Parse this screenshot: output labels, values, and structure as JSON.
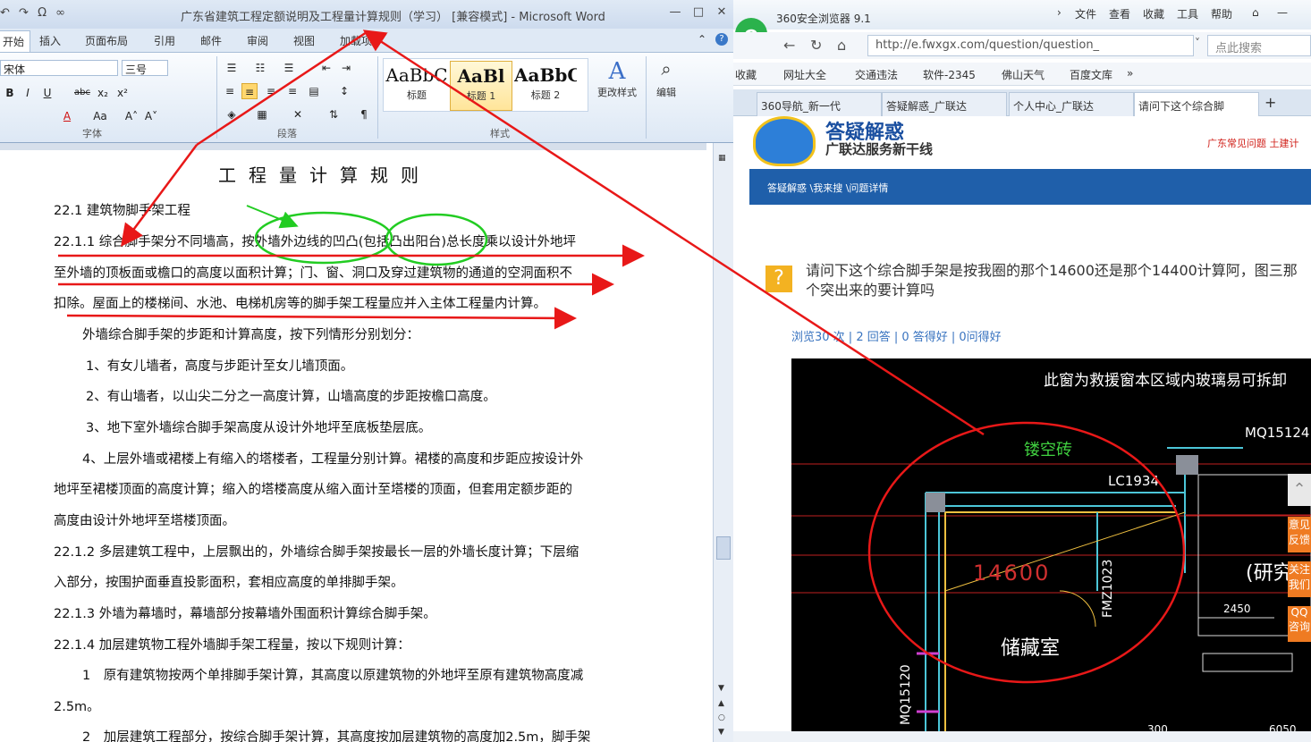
{
  "word": {
    "title": "广东省建筑工程定额说明及工程量计算规则（学习） [兼容模式] - Microsoft Word",
    "qat": [
      "↶",
      "↷",
      "Ω",
      "∞"
    ],
    "window_controls": [
      "—",
      "□",
      "✕"
    ],
    "tabs": [
      "开始",
      "插入",
      "页面布局",
      "引用",
      "邮件",
      "审阅",
      "视图",
      "加载项"
    ],
    "help_icons": [
      "⌃",
      "?"
    ],
    "ribbon": {
      "font_name": "宋体",
      "font_size": "三号",
      "group_font": "字体",
      "group_paragraph": "段落",
      "group_styles": "样式",
      "styles": [
        {
          "preview": "AaBbC",
          "label": "标题"
        },
        {
          "preview": "AaBl",
          "label": "标题 1"
        },
        {
          "preview": "AaBbC",
          "label": "标题 2"
        }
      ],
      "change_styles": "更改样式",
      "edit": "编辑",
      "format_buttons": [
        "B",
        "I",
        "U",
        "abc",
        "x₂",
        "x²",
        "A",
        "Aa",
        "A˄",
        "A˅"
      ]
    },
    "document": {
      "heading": "工程量计算规则",
      "lines": [
        "22.1 建筑物脚手架工程",
        "22.1.1 综合脚手架分不同墙高，按外墙外边线的凹凸(包括凸出阳台)总长度乘以设计外地坪",
        "至外墙的顶板面或檐口的高度以面积计算；门、窗、洞口及穿过建筑物的通道的空洞面积不",
        "扣除。屋面上的楼梯间、水池、电梯机房等的脚手架工程量应并入主体工程量内计算。",
        "外墙综合脚手架的步距和计算高度，按下列情形分别划分：",
        "1、有女儿墙者，高度与步距计至女儿墙顶面。",
        "2、有山墙者，以山尖二分之一高度计算，山墙高度的步距按檐口高度。",
        "3、地下室外墙综合脚手架高度从设计外地坪至底板垫层底。",
        "4、上层外墙或裙楼上有缩入的塔楼者，工程量分别计算。裙楼的高度和步距应按设计外",
        "地坪至裙楼顶面的高度计算；缩入的塔楼高度从缩入面计至塔楼的顶面，但套用定额步距的",
        "高度由设计外地坪至塔楼顶面。",
        "22.1.2 多层建筑工程中，上层飘出的，外墙综合脚手架按最长一层的外墙长度计算；下层缩",
        "入部分，按围护面垂直投影面积，套相应高度的单排脚手架。",
        "22.1.3 外墙为幕墙时，幕墙部分按幕墙外围面积计算综合脚手架。",
        "22.1.4 加层建筑物工程外墙脚手架工程量，按以下规则计算：",
        "1　原有建筑物按两个单排脚手架计算，其高度以原建筑物的外地坪至原有建筑物高度减",
        "2.5m。",
        "2　加层建筑工程部分，按综合脚手架计算，其高度按加层建筑物的高度加2.5m，脚手架"
      ]
    }
  },
  "browser": {
    "name": "360安全浏览器 9.1",
    "menu": [
      "文件",
      "查看",
      "收藏",
      "工具",
      "帮助"
    ],
    "address": "http://e.fwxgx.com/question/question_",
    "search_placeholder": "点此搜索",
    "bookmarks": [
      "收藏",
      "网址大全",
      "交通违法",
      "软件-2345",
      "佛山天气",
      "百度文库"
    ],
    "tabs": [
      "360导航_新一代",
      "答疑解惑_广联达",
      "个人中心_广联达",
      "请问下这个综合脚"
    ],
    "page": {
      "brand": "答疑解惑",
      "brand_sub": "广联达服务新干线",
      "top_links": "广东常见问题  土建计",
      "breadcrumb": "答疑解惑 \\我来搜 \\问题详情",
      "question": "请问下这个综合脚手架是按我圈的那个14600还是那个14400计算阿，图三那个突出来的要计算吗",
      "stats": "浏览30 次 | 2 回答 | 0 答得好 | 0问得好",
      "side_buttons": [
        "意见反馈",
        "关注我们",
        "QQ咨询"
      ],
      "cad_texts": {
        "note": "此窗为救援窗本区域内玻璃易可拆卸",
        "door1": "MQ15124",
        "hollow": "镂空砖",
        "window": "LC1934",
        "dim": "14600",
        "room": "储藏室",
        "door2": "FMZ1023",
        "door3": "MQ15120",
        "study": "(研究",
        "dim2": "2450",
        "dim3": "300",
        "dim4": "6050"
      }
    }
  },
  "colors": {
    "annotation_red": "#e81818",
    "annotation_green": "#22cc22",
    "cad_yellow": "#f0c040"
  }
}
